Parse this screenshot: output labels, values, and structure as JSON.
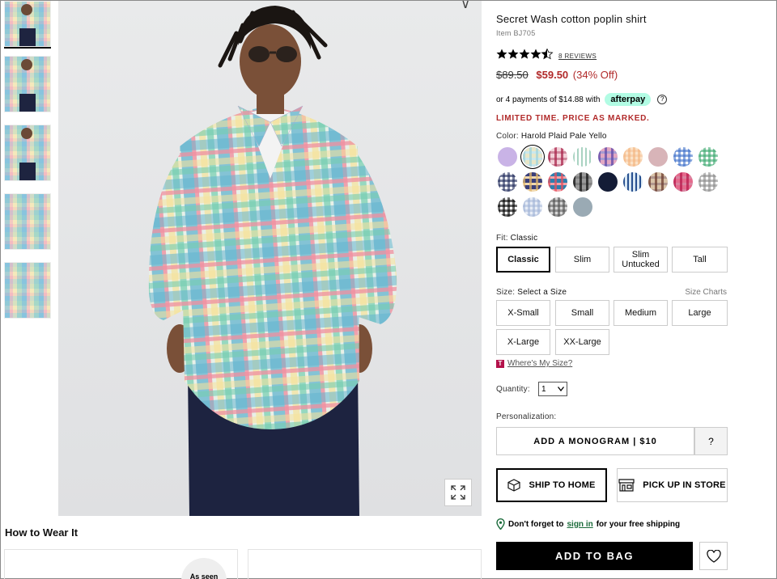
{
  "product": {
    "title": "Secret Wash cotton poplin shirt",
    "item_number": "Item BJ705",
    "rating_stars": 4.5,
    "reviews_link": "8 REVIEWS",
    "old_price": "$89.50",
    "new_price": "$59.50",
    "percent_off": "(34% Off)",
    "afterpay_text": "or 4 payments of $14.88 with",
    "afterpay_logo": "afterpay",
    "limited_notice": "LIMITED TIME. PRICE AS MARKED."
  },
  "color": {
    "label": "Color:",
    "selected": "Harold Plaid Pale Yello",
    "swatches": [
      {
        "name": "lavender",
        "c1": "#c9b3e6",
        "c2": "#d8c6ef",
        "type": "solid"
      },
      {
        "name": "pale-blue-plaid",
        "c1": "#9dd3dc",
        "c2": "#e8e6c8",
        "type": "plaid",
        "selected": true
      },
      {
        "name": "red-plaid",
        "c1": "#a8234a",
        "c2": "#f2d0d8",
        "type": "plaid"
      },
      {
        "name": "green-stripe",
        "c1": "#a9d3c2",
        "c2": "#ffffff",
        "type": "stripe"
      },
      {
        "name": "purple-plaid",
        "c1": "#5c46a8",
        "c2": "#e2a8c2",
        "type": "plaid"
      },
      {
        "name": "peach-check",
        "c1": "#f3b27a",
        "c2": "#fbe3c9",
        "type": "check"
      },
      {
        "name": "pink-solid",
        "c1": "#d8b4b8",
        "c2": "#ead3d5",
        "type": "solid"
      },
      {
        "name": "blue-gingham",
        "c1": "#3d6fc9",
        "c2": "#ffffff",
        "type": "check"
      },
      {
        "name": "green-gingham",
        "c1": "#3aa86e",
        "c2": "#ffffff",
        "type": "check"
      },
      {
        "name": "navy-check",
        "c1": "#1f2a5a",
        "c2": "#ffffff",
        "type": "check"
      },
      {
        "name": "multi-plaid",
        "c1": "#e0b56a",
        "c2": "#3a3f7a",
        "type": "plaid"
      },
      {
        "name": "coral-plaid",
        "c1": "#e4505e",
        "c2": "#2e7fae",
        "type": "plaid"
      },
      {
        "name": "black-plaid",
        "c1": "#111111",
        "c2": "#9a9a9a",
        "type": "plaid"
      },
      {
        "name": "navy-solid",
        "c1": "#141c36",
        "c2": "#141c36",
        "type": "solid"
      },
      {
        "name": "blue-stripe",
        "c1": "#264f8f",
        "c2": "#d8e7f3",
        "type": "stripe"
      },
      {
        "name": "brown-plaid",
        "c1": "#6a3a2c",
        "c2": "#d9c3a8",
        "type": "plaid"
      },
      {
        "name": "magenta-plaid",
        "c1": "#b8184c",
        "c2": "#e46b8d",
        "type": "plaid"
      },
      {
        "name": "grey-gingham",
        "c1": "#8a8a8a",
        "c2": "#ffffff",
        "type": "check"
      },
      {
        "name": "black-gingham",
        "c1": "#000000",
        "c2": "#ffffff",
        "type": "check"
      },
      {
        "name": "light-blue-check",
        "c1": "#9fb2d6",
        "c2": "#e8edf6",
        "type": "check"
      },
      {
        "name": "grey-plaid",
        "c1": "#4d4d4d",
        "c2": "#d8d8d8",
        "type": "check"
      },
      {
        "name": "slate-solid",
        "c1": "#9aaab4",
        "c2": "#b8c4cb",
        "type": "solid"
      }
    ]
  },
  "fit": {
    "label": "Fit:",
    "selected": "Classic",
    "options": [
      "Classic",
      "Slim",
      "Slim Untucked",
      "Tall"
    ]
  },
  "size": {
    "label": "Size:",
    "prompt": "Select a Size",
    "charts_link": "Size Charts",
    "options": [
      "X-Small",
      "Small",
      "Medium",
      "Large",
      "X-Large",
      "XX-Large"
    ],
    "where_link": "Where's My Size?",
    "where_icon": "T"
  },
  "quantity": {
    "label": "Quantity:",
    "value": "1"
  },
  "personalization": {
    "label": "Personalization:",
    "monogram": "ADD A MONOGRAM | $10",
    "help": "?"
  },
  "fulfillment": {
    "ship_home": "SHIP TO HOME",
    "pickup": "PICK UP IN STORE",
    "free_ship_pre": "Don't forget to",
    "free_ship_link": "sign in",
    "free_ship_post": "for your free shipping"
  },
  "cart": {
    "add_to_bag": "ADD TO BAG"
  },
  "how_to_wear": {
    "title": "How to Wear It",
    "badge": "As seen"
  }
}
